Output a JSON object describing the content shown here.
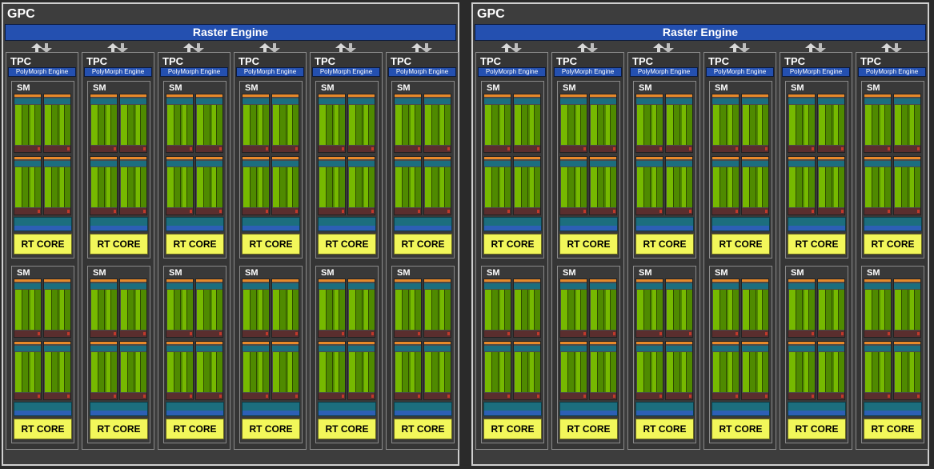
{
  "colors": {
    "background": "#2a2a2a",
    "gpc_fill": "#3d3d3d",
    "raster_engine": "#2450b0",
    "sm_core_green": "#76b900",
    "rt_core_yellow": "#f2f75a",
    "register_orange": "#e8892a",
    "cache_teal": "#1c6e7e"
  },
  "gpcs": [
    {
      "title": "GPC",
      "raster_engine": "Raster Engine",
      "tpcs": [
        {
          "label": "TPC",
          "polymorph": "PolyMorph Engine",
          "sms": [
            {
              "label": "SM",
              "rt_core": "RT CORE"
            },
            {
              "label": "SM",
              "rt_core": "RT CORE"
            }
          ]
        },
        {
          "label": "TPC",
          "polymorph": "PolyMorph Engine",
          "sms": [
            {
              "label": "SM",
              "rt_core": "RT CORE"
            },
            {
              "label": "SM",
              "rt_core": "RT CORE"
            }
          ]
        },
        {
          "label": "TPC",
          "polymorph": "PolyMorph Engine",
          "sms": [
            {
              "label": "SM",
              "rt_core": "RT CORE"
            },
            {
              "label": "SM",
              "rt_core": "RT CORE"
            }
          ]
        },
        {
          "label": "TPC",
          "polymorph": "PolyMorph Engine",
          "sms": [
            {
              "label": "SM",
              "rt_core": "RT CORE"
            },
            {
              "label": "SM",
              "rt_core": "RT CORE"
            }
          ]
        },
        {
          "label": "TPC",
          "polymorph": "PolyMorph Engine",
          "sms": [
            {
              "label": "SM",
              "rt_core": "RT CORE"
            },
            {
              "label": "SM",
              "rt_core": "RT CORE"
            }
          ]
        },
        {
          "label": "TPC",
          "polymorph": "PolyMorph Engine",
          "sms": [
            {
              "label": "SM",
              "rt_core": "RT CORE"
            },
            {
              "label": "SM",
              "rt_core": "RT CORE"
            }
          ]
        }
      ]
    },
    {
      "title": "GPC",
      "raster_engine": "Raster Engine",
      "tpcs": [
        {
          "label": "TPC",
          "polymorph": "PolyMorph Engine",
          "sms": [
            {
              "label": "SM",
              "rt_core": "RT CORE"
            },
            {
              "label": "SM",
              "rt_core": "RT CORE"
            }
          ]
        },
        {
          "label": "TPC",
          "polymorph": "PolyMorph Engine",
          "sms": [
            {
              "label": "SM",
              "rt_core": "RT CORE"
            },
            {
              "label": "SM",
              "rt_core": "RT CORE"
            }
          ]
        },
        {
          "label": "TPC",
          "polymorph": "PolyMorph Engine",
          "sms": [
            {
              "label": "SM",
              "rt_core": "RT CORE"
            },
            {
              "label": "SM",
              "rt_core": "RT CORE"
            }
          ]
        },
        {
          "label": "TPC",
          "polymorph": "PolyMorph Engine",
          "sms": [
            {
              "label": "SM",
              "rt_core": "RT CORE"
            },
            {
              "label": "SM",
              "rt_core": "RT CORE"
            }
          ]
        },
        {
          "label": "TPC",
          "polymorph": "PolyMorph Engine",
          "sms": [
            {
              "label": "SM",
              "rt_core": "RT CORE"
            },
            {
              "label": "SM",
              "rt_core": "RT CORE"
            }
          ]
        },
        {
          "label": "TPC",
          "polymorph": "PolyMorph Engine",
          "sms": [
            {
              "label": "SM",
              "rt_core": "RT CORE"
            },
            {
              "label": "SM",
              "rt_core": "RT CORE"
            }
          ]
        }
      ]
    }
  ]
}
